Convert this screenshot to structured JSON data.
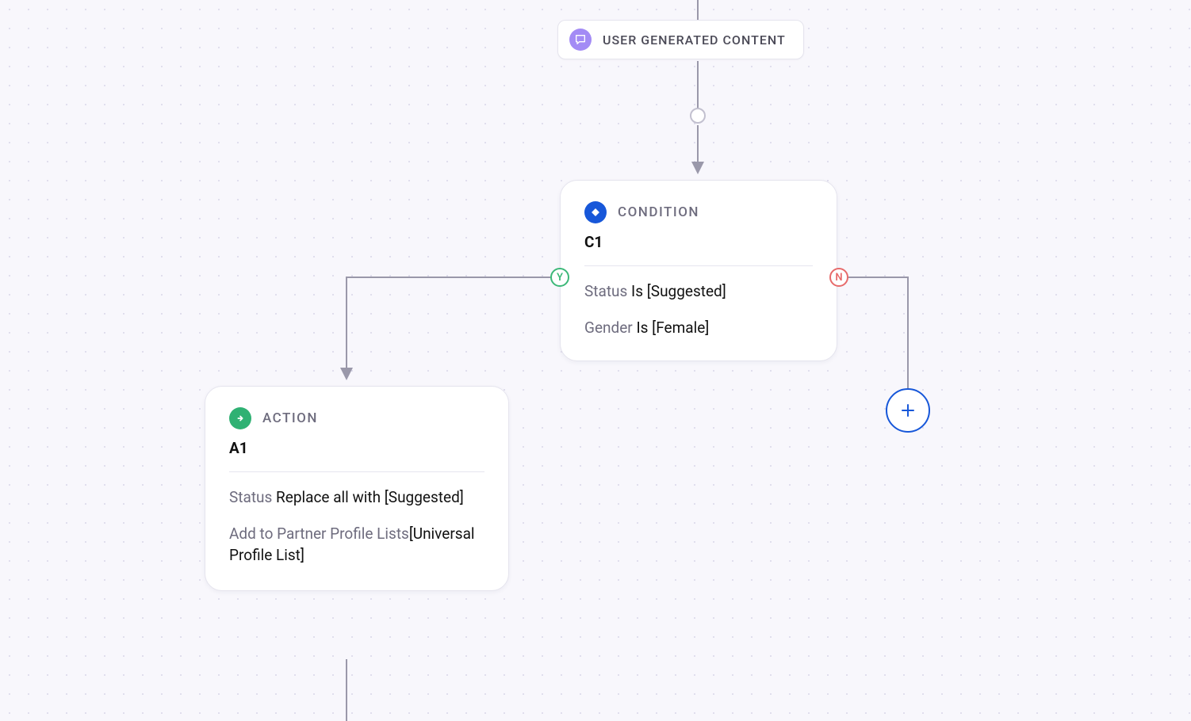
{
  "trigger": {
    "label": "USER GENERATED CONTENT",
    "icon": "message-icon"
  },
  "condition": {
    "type_label": "CONDITION",
    "id": "C1",
    "rules": [
      {
        "field": "Status",
        "op": "Is",
        "value": "[Suggested]"
      },
      {
        "field": "Gender",
        "op": "Is",
        "value": "[Female]"
      }
    ],
    "yes_badge": "Y",
    "no_badge": "N"
  },
  "action": {
    "type_label": "ACTION",
    "id": "A1",
    "rules": [
      {
        "field": "Status",
        "text": "Replace all with [Suggested]"
      },
      {
        "field": "Add to Partner Profile Lists",
        "text": "[Universal Profile List]"
      }
    ]
  },
  "buttons": {
    "add_icon": "plus-icon"
  },
  "colors": {
    "trigger_icon_bg": "#a38bf5",
    "condition_icon_bg": "#1757d9",
    "action_icon_bg": "#2fb173",
    "yes": "#3cb878",
    "no": "#e76a6a",
    "add_border": "#1757d9"
  }
}
